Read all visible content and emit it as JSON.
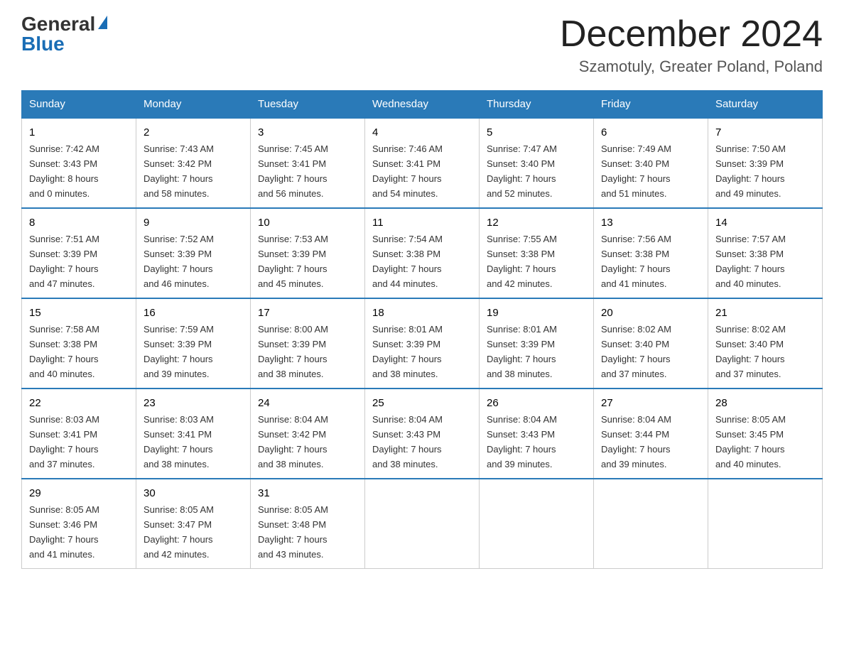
{
  "logo": {
    "general": "General",
    "blue": "Blue"
  },
  "header": {
    "month": "December 2024",
    "location": "Szamotuly, Greater Poland, Poland"
  },
  "days_of_week": [
    "Sunday",
    "Monday",
    "Tuesday",
    "Wednesday",
    "Thursday",
    "Friday",
    "Saturday"
  ],
  "weeks": [
    [
      {
        "day": "1",
        "sunrise": "7:42 AM",
        "sunset": "3:43 PM",
        "daylight": "8 hours and 0 minutes."
      },
      {
        "day": "2",
        "sunrise": "7:43 AM",
        "sunset": "3:42 PM",
        "daylight": "7 hours and 58 minutes."
      },
      {
        "day": "3",
        "sunrise": "7:45 AM",
        "sunset": "3:41 PM",
        "daylight": "7 hours and 56 minutes."
      },
      {
        "day": "4",
        "sunrise": "7:46 AM",
        "sunset": "3:41 PM",
        "daylight": "7 hours and 54 minutes."
      },
      {
        "day": "5",
        "sunrise": "7:47 AM",
        "sunset": "3:40 PM",
        "daylight": "7 hours and 52 minutes."
      },
      {
        "day": "6",
        "sunrise": "7:49 AM",
        "sunset": "3:40 PM",
        "daylight": "7 hours and 51 minutes."
      },
      {
        "day": "7",
        "sunrise": "7:50 AM",
        "sunset": "3:39 PM",
        "daylight": "7 hours and 49 minutes."
      }
    ],
    [
      {
        "day": "8",
        "sunrise": "7:51 AM",
        "sunset": "3:39 PM",
        "daylight": "7 hours and 47 minutes."
      },
      {
        "day": "9",
        "sunrise": "7:52 AM",
        "sunset": "3:39 PM",
        "daylight": "7 hours and 46 minutes."
      },
      {
        "day": "10",
        "sunrise": "7:53 AM",
        "sunset": "3:39 PM",
        "daylight": "7 hours and 45 minutes."
      },
      {
        "day": "11",
        "sunrise": "7:54 AM",
        "sunset": "3:38 PM",
        "daylight": "7 hours and 44 minutes."
      },
      {
        "day": "12",
        "sunrise": "7:55 AM",
        "sunset": "3:38 PM",
        "daylight": "7 hours and 42 minutes."
      },
      {
        "day": "13",
        "sunrise": "7:56 AM",
        "sunset": "3:38 PM",
        "daylight": "7 hours and 41 minutes."
      },
      {
        "day": "14",
        "sunrise": "7:57 AM",
        "sunset": "3:38 PM",
        "daylight": "7 hours and 40 minutes."
      }
    ],
    [
      {
        "day": "15",
        "sunrise": "7:58 AM",
        "sunset": "3:38 PM",
        "daylight": "7 hours and 40 minutes."
      },
      {
        "day": "16",
        "sunrise": "7:59 AM",
        "sunset": "3:39 PM",
        "daylight": "7 hours and 39 minutes."
      },
      {
        "day": "17",
        "sunrise": "8:00 AM",
        "sunset": "3:39 PM",
        "daylight": "7 hours and 38 minutes."
      },
      {
        "day": "18",
        "sunrise": "8:01 AM",
        "sunset": "3:39 PM",
        "daylight": "7 hours and 38 minutes."
      },
      {
        "day": "19",
        "sunrise": "8:01 AM",
        "sunset": "3:39 PM",
        "daylight": "7 hours and 38 minutes."
      },
      {
        "day": "20",
        "sunrise": "8:02 AM",
        "sunset": "3:40 PM",
        "daylight": "7 hours and 37 minutes."
      },
      {
        "day": "21",
        "sunrise": "8:02 AM",
        "sunset": "3:40 PM",
        "daylight": "7 hours and 37 minutes."
      }
    ],
    [
      {
        "day": "22",
        "sunrise": "8:03 AM",
        "sunset": "3:41 PM",
        "daylight": "7 hours and 37 minutes."
      },
      {
        "day": "23",
        "sunrise": "8:03 AM",
        "sunset": "3:41 PM",
        "daylight": "7 hours and 38 minutes."
      },
      {
        "day": "24",
        "sunrise": "8:04 AM",
        "sunset": "3:42 PM",
        "daylight": "7 hours and 38 minutes."
      },
      {
        "day": "25",
        "sunrise": "8:04 AM",
        "sunset": "3:43 PM",
        "daylight": "7 hours and 38 minutes."
      },
      {
        "day": "26",
        "sunrise": "8:04 AM",
        "sunset": "3:43 PM",
        "daylight": "7 hours and 39 minutes."
      },
      {
        "day": "27",
        "sunrise": "8:04 AM",
        "sunset": "3:44 PM",
        "daylight": "7 hours and 39 minutes."
      },
      {
        "day": "28",
        "sunrise": "8:05 AM",
        "sunset": "3:45 PM",
        "daylight": "7 hours and 40 minutes."
      }
    ],
    [
      {
        "day": "29",
        "sunrise": "8:05 AM",
        "sunset": "3:46 PM",
        "daylight": "7 hours and 41 minutes."
      },
      {
        "day": "30",
        "sunrise": "8:05 AM",
        "sunset": "3:47 PM",
        "daylight": "7 hours and 42 minutes."
      },
      {
        "day": "31",
        "sunrise": "8:05 AM",
        "sunset": "3:48 PM",
        "daylight": "7 hours and 43 minutes."
      },
      null,
      null,
      null,
      null
    ]
  ],
  "labels": {
    "sunrise": "Sunrise:",
    "sunset": "Sunset:",
    "daylight": "Daylight:"
  }
}
